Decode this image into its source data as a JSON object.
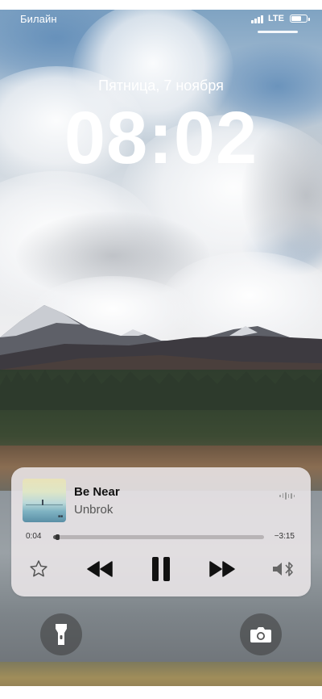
{
  "status_bar": {
    "carrier": "Билайн",
    "network": "LTE",
    "icons": [
      "signal-icon",
      "battery-icon"
    ]
  },
  "lock_screen": {
    "date": "Пятница, 7 ноября",
    "time": "08:02"
  },
  "now_playing": {
    "title": "Be Near",
    "artist": "Unbrok",
    "elapsed": "0:04",
    "remaining": "−3:15",
    "progress": 0.02,
    "controls": [
      "star-icon",
      "rewind-icon",
      "pause-icon",
      "fast-forward-icon",
      "bluetooth-speaker-icon"
    ]
  },
  "shortcuts": {
    "left": "flashlight-icon",
    "right": "camera-icon"
  },
  "colors": {
    "text_on_wallpaper": "#ffffff",
    "widget_background": "#ebe6e8",
    "control_glyphs": "#111111"
  }
}
